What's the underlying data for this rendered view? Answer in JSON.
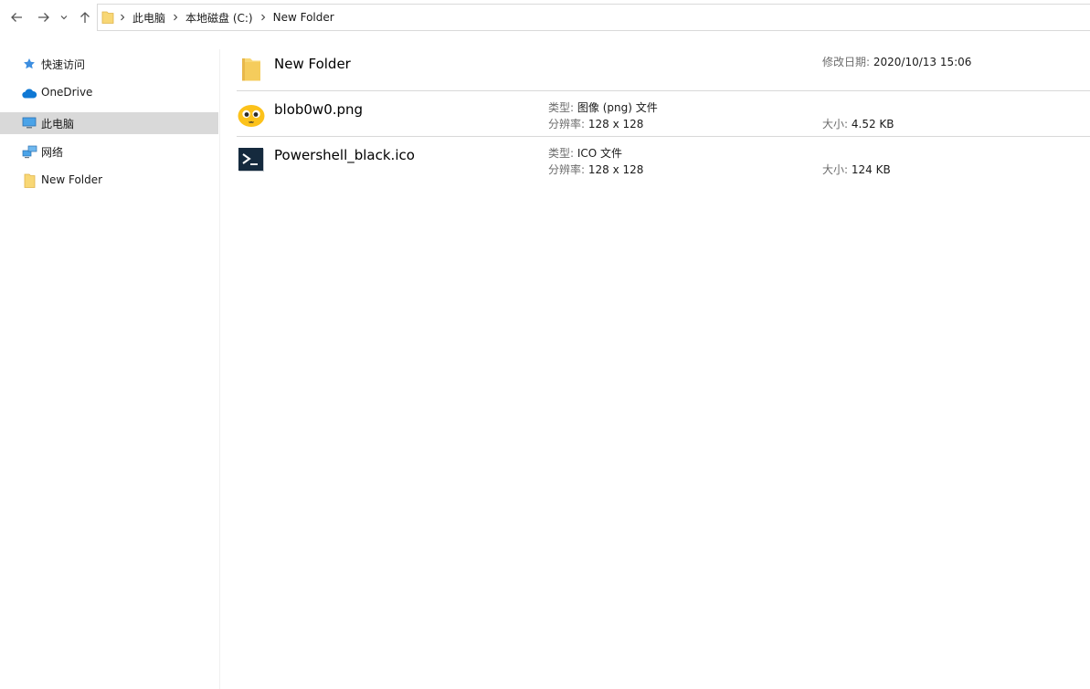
{
  "address_bar": {
    "crumbs": [
      "此电脑",
      "本地磁盘 (C:)",
      "New Folder"
    ]
  },
  "sidebar": {
    "items": [
      {
        "label": "快速访问",
        "icon": "star-icon"
      },
      {
        "label": "OneDrive",
        "icon": "cloud-icon"
      },
      {
        "label": "此电脑",
        "icon": "computer-icon",
        "selected": true
      },
      {
        "label": "网络",
        "icon": "network-icon"
      },
      {
        "label": "New Folder",
        "icon": "folder-icon"
      }
    ]
  },
  "files": [
    {
      "name": "New Folder",
      "icon": "folder-icon",
      "date_label": "修改日期:",
      "date_value": "2020/10/13 15:06"
    },
    {
      "name": "blob0w0.png",
      "icon": "blob-emoji-icon",
      "type_label": "类型:",
      "type_value": "图像 (png) 文件",
      "res_label": "分辨率:",
      "res_value": "128 x 128",
      "size_label": "大小:",
      "size_value": "4.52 KB"
    },
    {
      "name": "Powershell_black.ico",
      "icon": "powershell-icon",
      "type_label": "类型:",
      "type_value": "ICO 文件",
      "res_label": "分辨率:",
      "res_value": "128 x 128",
      "size_label": "大小:",
      "size_value": "124 KB"
    }
  ],
  "colors": {
    "folder_yellow": "#f8d775",
    "folder_dark": "#e8b84a",
    "selection": "#d9d9d9",
    "onedrive_blue": "#0f78d4",
    "blob_yellow": "#fcc21b",
    "powershell_bg": "#152a3e"
  }
}
